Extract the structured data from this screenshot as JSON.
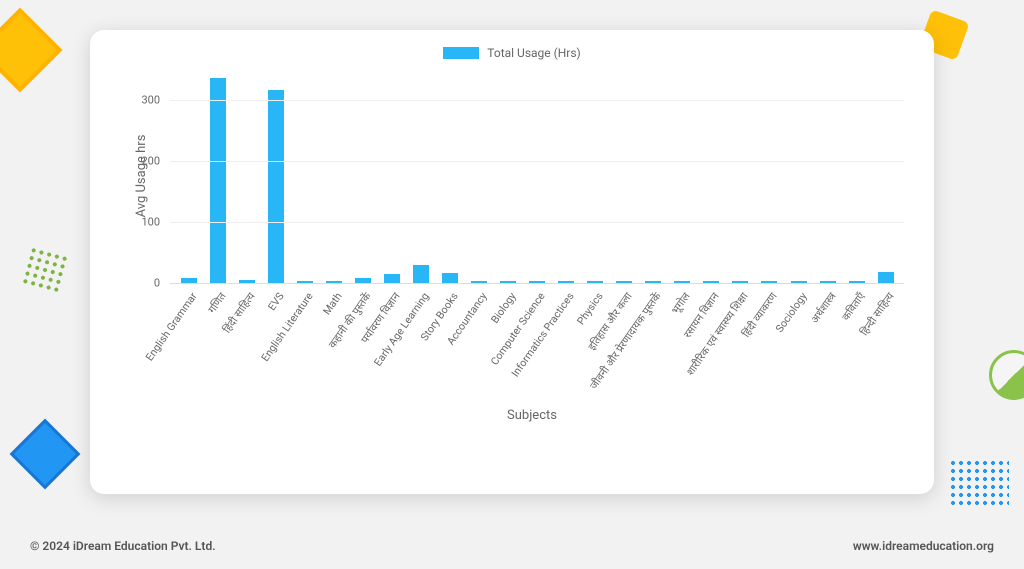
{
  "legend": {
    "label": "Total Usage (Hrs)"
  },
  "y_axis": {
    "label": "Avg Usage hrs"
  },
  "x_axis": {
    "label": "Subjects"
  },
  "footer": {
    "copyright": "© 2024 iDream Education Pvt. Ltd.",
    "url": "www.idreameducation.org"
  },
  "colors": {
    "bar": "#29b6f6"
  },
  "chart_data": {
    "type": "bar",
    "title": "",
    "xlabel": "Subjects",
    "ylabel": "Avg Usage hrs",
    "ylim": [
      0,
      350
    ],
    "yticks": [
      0,
      100,
      200,
      300
    ],
    "categories": [
      "English Grammar",
      "गणित",
      "हिंदी साहित्य",
      "EVS",
      "English Literature",
      "Math",
      "कहानी की पुस्तकें",
      "पर्यावरण विज्ञान",
      "Early Age Learning",
      "Story Books",
      "Accountancy",
      "Biology",
      "Computer Science",
      "Informatics Practices",
      "Physics",
      "इतिहास और कला",
      "जीवनी और प्रेरणादायक पुस्तकें",
      "भूगोल",
      "रसायन विज्ञान",
      "शारीरिक एवं स्वास्थ्य शिक्षा",
      "हिंदी व्याकरण",
      "Sociology",
      "अर्थशास्त्र",
      "कविताएँ",
      "हिन्दी साहित्य"
    ],
    "values": [
      9,
      335,
      5,
      315,
      2,
      2,
      9,
      14,
      30,
      17,
      3,
      1,
      1,
      1,
      1,
      1,
      1,
      1,
      1,
      1,
      1,
      1,
      1,
      1,
      18
    ]
  }
}
